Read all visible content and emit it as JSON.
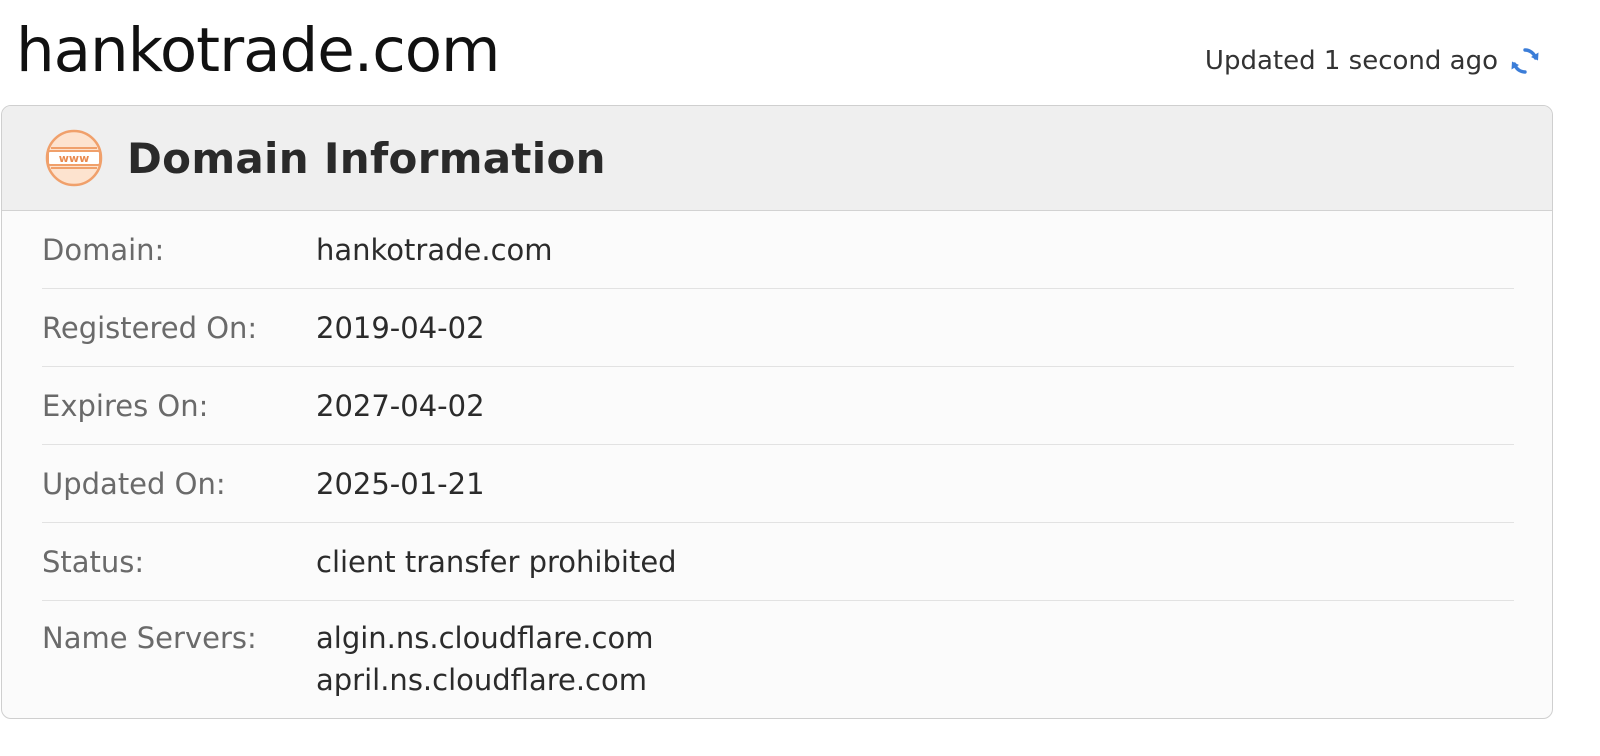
{
  "page": {
    "title": "hankotrade.com",
    "updated_text": "Updated 1 second ago"
  },
  "card": {
    "title": "Domain Information",
    "icon_text": "www",
    "rows": [
      {
        "label": "Domain:",
        "value": "hankotrade.com"
      },
      {
        "label": "Registered On:",
        "value": "2019-04-02"
      },
      {
        "label": "Expires On:",
        "value": "2027-04-02"
      },
      {
        "label": "Updated On:",
        "value": "2025-01-21"
      },
      {
        "label": "Status:",
        "value": "client transfer prohibited"
      }
    ],
    "name_servers": {
      "label": "Name Servers:",
      "values": [
        "algin.ns.cloudflare.com",
        "april.ns.cloudflare.com"
      ]
    }
  },
  "colors": {
    "accent_icon": "#f0a06b",
    "refresh_icon": "#3b7dd8",
    "header_bg": "#efefef"
  },
  "icons": {
    "header": "www-globe-icon",
    "refresh": "refresh-icon"
  }
}
